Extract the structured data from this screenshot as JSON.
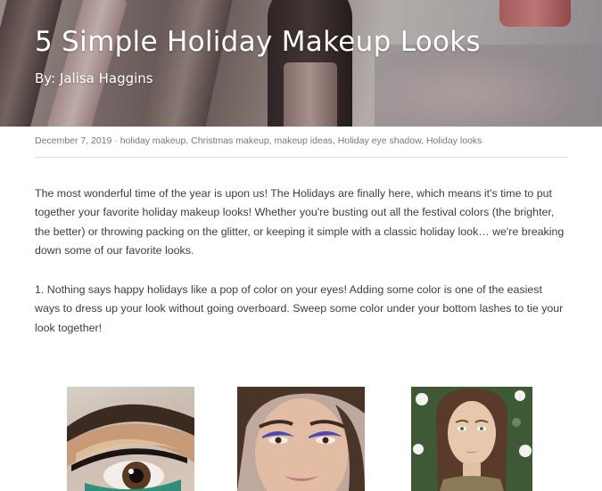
{
  "article": {
    "title": "5 Simple Holiday Makeup Looks",
    "byline": "By: Jalisa Haggins"
  },
  "meta": {
    "date": "December 7, 2019",
    "separator": " · ",
    "tags": [
      "holiday makeup",
      "Christmas makeup",
      "makeup ideas",
      "Holiday eye shadow",
      "Holiday looks"
    ]
  },
  "body": {
    "paragraphs": [
      "The most wonderful time of the year is upon us! The Holidays are finally here, which means it's time to put together your favorite holiday makeup looks! Whether you're busting out all the festival colors (the brighter, the better) or throwing packing on the glitter, or keeping it simple with a classic holiday look… we're breaking down some of our favorite looks.",
      "1. Nothing says happy holidays like a pop of color on your eyes! Adding some color is one of the easiest ways to dress up your look without going overboard. Sweep some color under your bottom lashes to tie your look together!"
    ]
  },
  "images": [
    {
      "icon": "eye-closeup-photo"
    },
    {
      "icon": "blue-eyeshadow-portrait-photo"
    },
    {
      "icon": "woman-portrait-photo"
    }
  ]
}
